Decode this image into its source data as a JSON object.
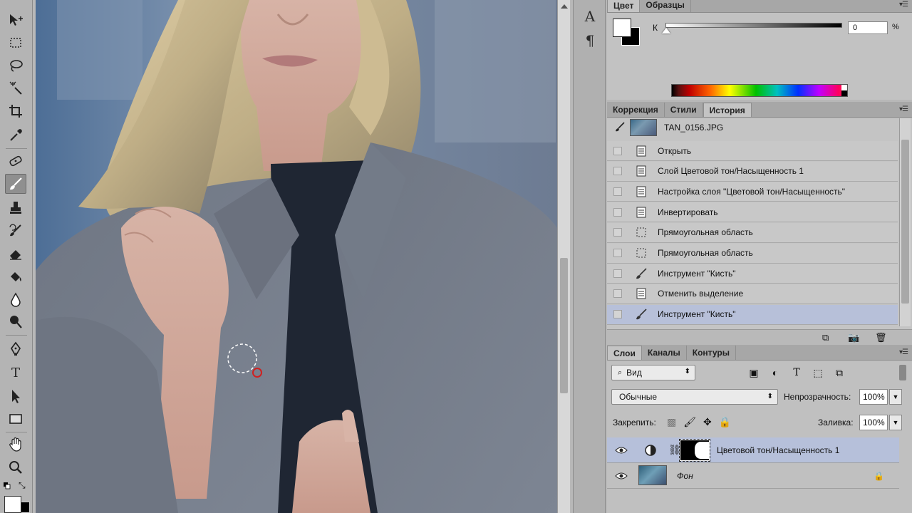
{
  "tools": [
    {
      "name": "move-tool-icon"
    },
    {
      "name": "rect-marquee-tool-icon"
    },
    {
      "name": "lasso-tool-icon"
    },
    {
      "name": "magic-wand-tool-icon"
    },
    {
      "name": "crop-tool-icon"
    },
    {
      "name": "eyedropper-tool-icon"
    },
    {
      "name": "spot-healing-tool-icon"
    },
    {
      "name": "brush-tool-icon",
      "active": true
    },
    {
      "name": "clone-stamp-tool-icon"
    },
    {
      "name": "history-brush-tool-icon"
    },
    {
      "name": "eraser-tool-icon"
    },
    {
      "name": "paint-bucket-tool-icon"
    },
    {
      "name": "blur-tool-icon"
    },
    {
      "name": "dodge-tool-icon"
    },
    {
      "name": "pen-tool-icon"
    },
    {
      "name": "type-tool-icon"
    },
    {
      "name": "path-selection-tool-icon"
    },
    {
      "name": "rectangle-shape-tool-icon"
    },
    {
      "name": "hand-tool-icon"
    },
    {
      "name": "zoom-tool-icon"
    }
  ],
  "dock": {
    "character_glyph": "A",
    "paragraph_glyph": "¶"
  },
  "color_panel": {
    "tabs": [
      "Цвет",
      "Образцы"
    ],
    "active_tab": "Цвет",
    "channel_label": "К",
    "value": "0",
    "unit": "%",
    "foreground": "#ffffff",
    "background": "#000000"
  },
  "history_panel": {
    "tabs": [
      "Коррекция",
      "Стили",
      "История"
    ],
    "active_tab": "История",
    "snapshot_name": "TAN_0156.JPG",
    "items": [
      {
        "label": "Открыть",
        "icon": "doc-icon"
      },
      {
        "label": "Слой Цветовой тон/Насыщенность 1",
        "icon": "doc-icon"
      },
      {
        "label": "Настройка слоя \"Цветовой тон/Насыщенность\"",
        "icon": "doc-icon"
      },
      {
        "label": "Инвертировать",
        "icon": "doc-icon"
      },
      {
        "label": "Прямоугольная область",
        "icon": "marquee-icon"
      },
      {
        "label": "Прямоугольная область",
        "icon": "marquee-icon"
      },
      {
        "label": "Инструмент \"Кисть\"",
        "icon": "brush-icon"
      },
      {
        "label": "Отменить выделение",
        "icon": "doc-icon"
      },
      {
        "label": "Инструмент \"Кисть\"",
        "icon": "brush-icon",
        "selected": true
      }
    ]
  },
  "layers_panel": {
    "tabs": [
      "Слои",
      "Каналы",
      "Контуры"
    ],
    "active_tab": "Слои",
    "filter_kind": "Вид",
    "blend_mode": "Обычные",
    "opacity_label": "Непрозрачность:",
    "opacity": "100%",
    "lock_label": "Закрепить:",
    "fill_label": "Заливка:",
    "fill": "100%",
    "layers": [
      {
        "name": "Цветовой тон/Насыщенность 1",
        "type": "adjustment",
        "selected": true
      },
      {
        "name": "Фон",
        "type": "background",
        "locked": true
      }
    ]
  }
}
